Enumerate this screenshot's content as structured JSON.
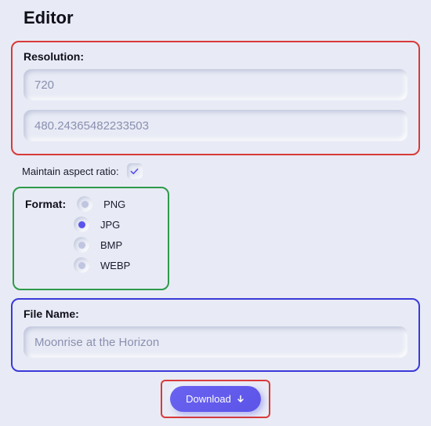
{
  "title": "Editor",
  "resolution": {
    "label": "Resolution:",
    "width_placeholder": "720",
    "width_value": "",
    "height_placeholder": "480.24365482233503",
    "height_value": ""
  },
  "aspect": {
    "label": "Maintain aspect ratio:",
    "checked": true
  },
  "format": {
    "label": "Format:",
    "options": [
      "PNG",
      "JPG",
      "BMP",
      "WEBP"
    ],
    "selected": "JPG"
  },
  "filename": {
    "label": "File Name:",
    "placeholder": "Moonrise at the Horizon",
    "value": ""
  },
  "download": {
    "label": "Download"
  },
  "colors": {
    "accent": "#5a54ec",
    "group_red": "#d93a3a",
    "group_green": "#2e9a4a",
    "group_blue": "#3a3ad9"
  }
}
